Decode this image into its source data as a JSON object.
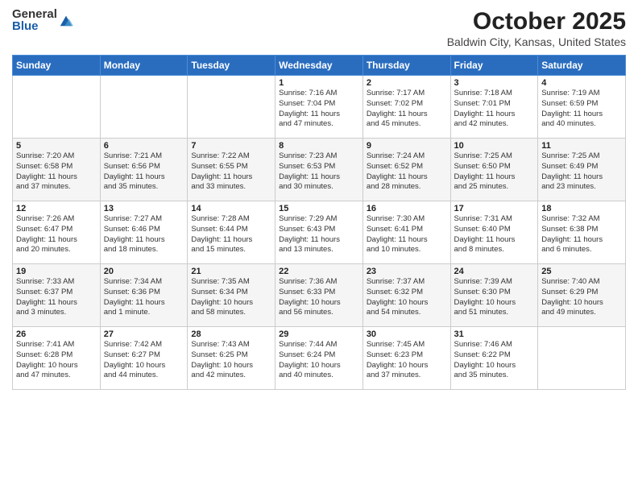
{
  "logo": {
    "general": "General",
    "blue": "Blue"
  },
  "header": {
    "title": "October 2025",
    "subtitle": "Baldwin City, Kansas, United States"
  },
  "weekdays": [
    "Sunday",
    "Monday",
    "Tuesday",
    "Wednesday",
    "Thursday",
    "Friday",
    "Saturday"
  ],
  "weeks": [
    [
      {
        "day": "",
        "info": ""
      },
      {
        "day": "",
        "info": ""
      },
      {
        "day": "",
        "info": ""
      },
      {
        "day": "1",
        "info": "Sunrise: 7:16 AM\nSunset: 7:04 PM\nDaylight: 11 hours\nand 47 minutes."
      },
      {
        "day": "2",
        "info": "Sunrise: 7:17 AM\nSunset: 7:02 PM\nDaylight: 11 hours\nand 45 minutes."
      },
      {
        "day": "3",
        "info": "Sunrise: 7:18 AM\nSunset: 7:01 PM\nDaylight: 11 hours\nand 42 minutes."
      },
      {
        "day": "4",
        "info": "Sunrise: 7:19 AM\nSunset: 6:59 PM\nDaylight: 11 hours\nand 40 minutes."
      }
    ],
    [
      {
        "day": "5",
        "info": "Sunrise: 7:20 AM\nSunset: 6:58 PM\nDaylight: 11 hours\nand 37 minutes."
      },
      {
        "day": "6",
        "info": "Sunrise: 7:21 AM\nSunset: 6:56 PM\nDaylight: 11 hours\nand 35 minutes."
      },
      {
        "day": "7",
        "info": "Sunrise: 7:22 AM\nSunset: 6:55 PM\nDaylight: 11 hours\nand 33 minutes."
      },
      {
        "day": "8",
        "info": "Sunrise: 7:23 AM\nSunset: 6:53 PM\nDaylight: 11 hours\nand 30 minutes."
      },
      {
        "day": "9",
        "info": "Sunrise: 7:24 AM\nSunset: 6:52 PM\nDaylight: 11 hours\nand 28 minutes."
      },
      {
        "day": "10",
        "info": "Sunrise: 7:25 AM\nSunset: 6:50 PM\nDaylight: 11 hours\nand 25 minutes."
      },
      {
        "day": "11",
        "info": "Sunrise: 7:25 AM\nSunset: 6:49 PM\nDaylight: 11 hours\nand 23 minutes."
      }
    ],
    [
      {
        "day": "12",
        "info": "Sunrise: 7:26 AM\nSunset: 6:47 PM\nDaylight: 11 hours\nand 20 minutes."
      },
      {
        "day": "13",
        "info": "Sunrise: 7:27 AM\nSunset: 6:46 PM\nDaylight: 11 hours\nand 18 minutes."
      },
      {
        "day": "14",
        "info": "Sunrise: 7:28 AM\nSunset: 6:44 PM\nDaylight: 11 hours\nand 15 minutes."
      },
      {
        "day": "15",
        "info": "Sunrise: 7:29 AM\nSunset: 6:43 PM\nDaylight: 11 hours\nand 13 minutes."
      },
      {
        "day": "16",
        "info": "Sunrise: 7:30 AM\nSunset: 6:41 PM\nDaylight: 11 hours\nand 10 minutes."
      },
      {
        "day": "17",
        "info": "Sunrise: 7:31 AM\nSunset: 6:40 PM\nDaylight: 11 hours\nand 8 minutes."
      },
      {
        "day": "18",
        "info": "Sunrise: 7:32 AM\nSunset: 6:38 PM\nDaylight: 11 hours\nand 6 minutes."
      }
    ],
    [
      {
        "day": "19",
        "info": "Sunrise: 7:33 AM\nSunset: 6:37 PM\nDaylight: 11 hours\nand 3 minutes."
      },
      {
        "day": "20",
        "info": "Sunrise: 7:34 AM\nSunset: 6:36 PM\nDaylight: 11 hours\nand 1 minute."
      },
      {
        "day": "21",
        "info": "Sunrise: 7:35 AM\nSunset: 6:34 PM\nDaylight: 10 hours\nand 58 minutes."
      },
      {
        "day": "22",
        "info": "Sunrise: 7:36 AM\nSunset: 6:33 PM\nDaylight: 10 hours\nand 56 minutes."
      },
      {
        "day": "23",
        "info": "Sunrise: 7:37 AM\nSunset: 6:32 PM\nDaylight: 10 hours\nand 54 minutes."
      },
      {
        "day": "24",
        "info": "Sunrise: 7:39 AM\nSunset: 6:30 PM\nDaylight: 10 hours\nand 51 minutes."
      },
      {
        "day": "25",
        "info": "Sunrise: 7:40 AM\nSunset: 6:29 PM\nDaylight: 10 hours\nand 49 minutes."
      }
    ],
    [
      {
        "day": "26",
        "info": "Sunrise: 7:41 AM\nSunset: 6:28 PM\nDaylight: 10 hours\nand 47 minutes."
      },
      {
        "day": "27",
        "info": "Sunrise: 7:42 AM\nSunset: 6:27 PM\nDaylight: 10 hours\nand 44 minutes."
      },
      {
        "day": "28",
        "info": "Sunrise: 7:43 AM\nSunset: 6:25 PM\nDaylight: 10 hours\nand 42 minutes."
      },
      {
        "day": "29",
        "info": "Sunrise: 7:44 AM\nSunset: 6:24 PM\nDaylight: 10 hours\nand 40 minutes."
      },
      {
        "day": "30",
        "info": "Sunrise: 7:45 AM\nSunset: 6:23 PM\nDaylight: 10 hours\nand 37 minutes."
      },
      {
        "day": "31",
        "info": "Sunrise: 7:46 AM\nSunset: 6:22 PM\nDaylight: 10 hours\nand 35 minutes."
      },
      {
        "day": "",
        "info": ""
      }
    ]
  ]
}
